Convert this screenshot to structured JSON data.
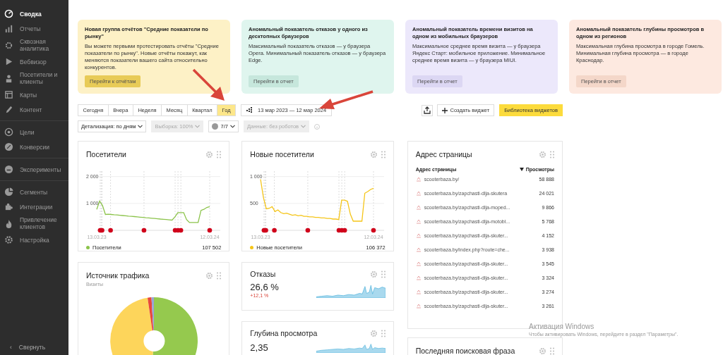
{
  "sidebar": {
    "groups": [
      [
        {
          "label": "Сводка",
          "selected": true
        },
        {
          "label": "Отчеты",
          "selected": false
        },
        {
          "label": "Сквозная аналитика",
          "selected": false
        },
        {
          "label": "Вебвизор",
          "selected": false
        },
        {
          "label": "Посетители и клиенты",
          "selected": false
        },
        {
          "label": "Карты",
          "selected": false
        },
        {
          "label": "Контент",
          "selected": false
        }
      ],
      [
        {
          "label": "Цели",
          "selected": false
        },
        {
          "label": "Конверсии",
          "selected": false
        }
      ],
      [
        {
          "label": "Эксперименты",
          "selected": false
        }
      ],
      [
        {
          "label": "Сегменты",
          "selected": false
        },
        {
          "label": "Интеграции",
          "selected": false
        },
        {
          "label": "Привлечение клиентов",
          "selected": false
        },
        {
          "label": "Настройка",
          "selected": false
        }
      ]
    ],
    "collapse": {
      "icon": "‹",
      "label": "Свернуть"
    }
  },
  "notices": [
    {
      "title": "Новая группа отчётов \"Средние показатели по рынку\"",
      "text": "Вы можете первыми протестировать отчёты \"Средние показатели по рынку\". Новые отчёты покажут, как меняются показатели вашего сайта относительно конкурентов.",
      "button": "Перейти к отчётам",
      "color": "#fdf1c6"
    },
    {
      "title": "Аномальный показатель отказов у одного из десктопных браузеров",
      "text": "Максимальный показатель отказов — у браузера Opera. Минимальный показатель отказов — у браузера Edge.",
      "button": "Перейти в отчет",
      "color": "#dff5ee"
    },
    {
      "title": "Аномальный показатель времени визитов на одном из мобильных браузеров",
      "text": "Максимальное среднее время визита — у браузера Яндекс Старт: мобильное приложение. Минимальное среднее время визита — у браузера MIUI.",
      "button": "Перейти в отчет",
      "color": "#ece8fb"
    },
    {
      "title": "Аномальный показатель глубины просмотров в одном из регионов",
      "text": "Максимальная глубина просмотра в городе Гомель. Минимальная глубина просмотра — в городе Краснодар.",
      "button": "Перейти в отчет",
      "color": "#fde9e0"
    }
  ],
  "periods": [
    {
      "label": "Сегодня",
      "selected": false
    },
    {
      "label": "Вчера",
      "selected": false
    },
    {
      "label": "Неделя",
      "selected": false
    },
    {
      "label": "Месяц",
      "selected": false
    },
    {
      "label": "Квартал",
      "selected": false
    },
    {
      "label": "Год",
      "selected": true
    }
  ],
  "date_range": "13 мар 2023 — 12 мар 2024",
  "actions": {
    "create_widget": "Создать виджет",
    "library": "Библиотека виджетов"
  },
  "filters": [
    {
      "kind": "plain",
      "label": "Детализация: по дням",
      "disabled": false
    },
    {
      "kind": "plain",
      "label": "Выборка: 100%",
      "disabled": true
    },
    {
      "kind": "segment",
      "label": "7/7",
      "disabled": false
    },
    {
      "kind": "plain",
      "label": "Данные: без роботов",
      "disabled": true
    }
  ],
  "visitors": {
    "title": "Посетители",
    "total": "107 502",
    "chart_data": {
      "type": "line",
      "categories": [
        "13.03.23",
        null,
        null,
        null,
        null,
        null,
        null,
        null,
        null,
        null,
        null,
        null,
        null,
        null,
        null,
        null,
        null,
        null,
        null,
        null,
        null,
        null,
        null,
        null,
        null,
        null,
        null,
        null,
        null,
        null,
        null,
        null,
        null,
        null,
        null,
        null,
        null,
        null,
        null,
        "12.03.24"
      ],
      "ylim": [
        0,
        2200
      ],
      "yticks": [
        {
          "value": 1000,
          "label": "1 000"
        },
        {
          "value": 2000,
          "label": "2 000"
        }
      ],
      "series": [
        {
          "name": "Посетители",
          "color": "#8bc34a",
          "values": [
            780,
            1090,
            920,
            590,
            600,
            590,
            580,
            570,
            560,
            550,
            540,
            530,
            520,
            510,
            500,
            490,
            480,
            470,
            460,
            450,
            440,
            430,
            420,
            410,
            400,
            390,
            380,
            500,
            660,
            660,
            660,
            400,
            290,
            290,
            290,
            290,
            740,
            780,
            850,
            880
          ]
        }
      ]
    }
  },
  "new_visitors": {
    "title": "Новые посетители",
    "total": "106 372",
    "chart_data": {
      "type": "line",
      "categories": [
        "13.03.23",
        null,
        null,
        null,
        null,
        null,
        null,
        null,
        null,
        null,
        null,
        null,
        null,
        null,
        null,
        null,
        null,
        null,
        null,
        null,
        null,
        null,
        null,
        null,
        null,
        null,
        null,
        null,
        null,
        null,
        null,
        null,
        null,
        null,
        null,
        null,
        null,
        null,
        null,
        "12.03.24"
      ],
      "ylim": [
        0,
        1100
      ],
      "yticks": [
        {
          "value": 500,
          "label": "500"
        },
        {
          "value": 1000,
          "label": "1 000"
        }
      ],
      "series": [
        {
          "name": "Новые посетители",
          "color": "#f5c518",
          "values": [
            950,
            610,
            400,
            410,
            440,
            350,
            380,
            330,
            310,
            320,
            300,
            280,
            290,
            270,
            280,
            260,
            260,
            250,
            250,
            240,
            240,
            230,
            230,
            220,
            220,
            210,
            210,
            200,
            560,
            560,
            540,
            300,
            170,
            170,
            170,
            170,
            690,
            720,
            760,
            780
          ]
        }
      ]
    }
  },
  "pages": {
    "title": "Адрес страницы",
    "columns": [
      "Адрес страницы",
      "Просмотры"
    ],
    "rows": [
      {
        "url": "scooterbaza.by/",
        "views": "58 888"
      },
      {
        "url": "scooterbaza.by/zapchasti-dlja-skutera",
        "views": "24 021"
      },
      {
        "url": "scooterbaza.by/zapchasti-dlja-moped...",
        "views": "9 866"
      },
      {
        "url": "scooterbaza.by/zapchasti-dlja-motobl...",
        "views": "5 768"
      },
      {
        "url": "scooterbaza.by/zapchasti-dlja-skuter...",
        "views": "4 152"
      },
      {
        "url": "scooterbaza.by/index.php?route=che...",
        "views": "3 938"
      },
      {
        "url": "scooterbaza.by/zapchasti-dlja-skuter...",
        "views": "3 545"
      },
      {
        "url": "scooterbaza.by/zapchasti-dlja-skuter...",
        "views": "3 324"
      },
      {
        "url": "scooterbaza.by/zapchasti-dlja-skuter...",
        "views": "3 274"
      },
      {
        "url": "scooterbaza.by/zapchasti-dlja-skuter...",
        "views": "3 261"
      }
    ]
  },
  "traffic": {
    "title": "Источник трафика",
    "subtitle": "Визиты"
  },
  "bounce": {
    "title": "Отказы",
    "value": "26,6 %",
    "change": "+12,1 %"
  },
  "depth": {
    "title": "Глубина просмотра",
    "value": "2,35"
  },
  "search_phrase": {
    "title": "Последняя поисковая фраза"
  },
  "os_notice": {
    "title": "Активация Windows",
    "text": "Чтобы активировать Windows, перейдите в раздел \"Параметры\"."
  }
}
